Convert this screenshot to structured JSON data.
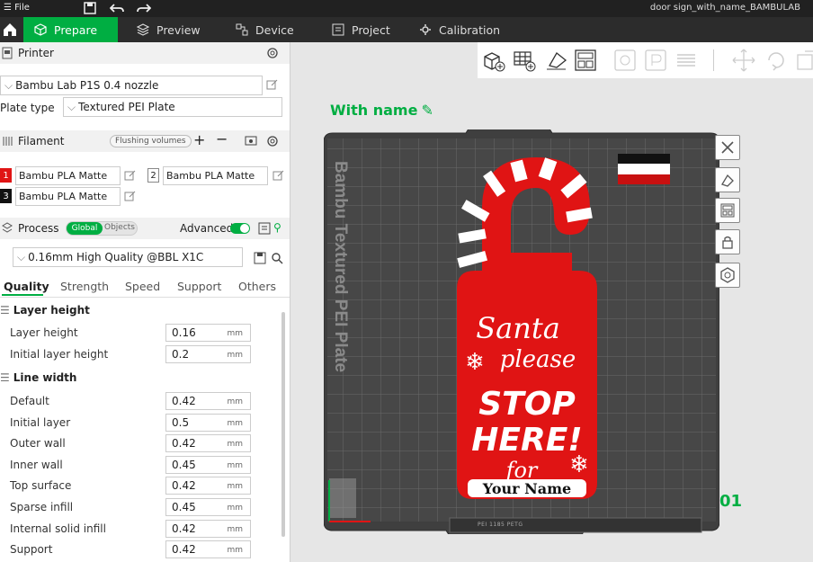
{
  "titlebar": {
    "menu_file": "File",
    "document_title": "door sign_with_name_BAMBULAB"
  },
  "tabs": [
    {
      "label": "Prepare"
    },
    {
      "label": "Preview"
    },
    {
      "label": "Device"
    },
    {
      "label": "Project"
    },
    {
      "label": "Calibration"
    }
  ],
  "printer": {
    "title": "Printer",
    "model": "Bambu Lab P1S 0.4 nozzle",
    "plate_type_label": "Plate type",
    "plate_type": "Textured PEI Plate"
  },
  "filament": {
    "title": "Filament",
    "flushing_label": "Flushing volumes",
    "slots": [
      {
        "num": "1",
        "name": "Bambu PLA Matte",
        "color": "#e01414"
      },
      {
        "num": "2",
        "name": "Bambu PLA Matte",
        "color": "#ffffff"
      },
      {
        "num": "3",
        "name": "Bambu PLA Matte",
        "color": "#111111"
      }
    ]
  },
  "process": {
    "title": "Process",
    "toggle_global": "Global",
    "toggle_objects": "Objects",
    "advanced_label": "Advanced",
    "preset": "0.16mm High Quality @BBL X1C",
    "tabs": [
      "Quality",
      "Strength",
      "Speed",
      "Support",
      "Others"
    ],
    "layer_height": {
      "group": "Layer height",
      "rows": [
        {
          "label": "Layer height",
          "value": "0.16",
          "unit": "mm"
        },
        {
          "label": "Initial layer height",
          "value": "0.2",
          "unit": "mm"
        }
      ]
    },
    "line_width": {
      "group": "Line width",
      "rows": [
        {
          "label": "Default",
          "value": "0.42",
          "unit": "mm"
        },
        {
          "label": "Initial layer",
          "value": "0.5",
          "unit": "mm"
        },
        {
          "label": "Outer wall",
          "value": "0.42",
          "unit": "mm"
        },
        {
          "label": "Inner wall",
          "value": "0.45",
          "unit": "mm"
        },
        {
          "label": "Top surface",
          "value": "0.42",
          "unit": "mm"
        },
        {
          "label": "Sparse infill",
          "value": "0.45",
          "unit": "mm"
        },
        {
          "label": "Internal solid infill",
          "value": "0.42",
          "unit": "mm"
        },
        {
          "label": "Support",
          "value": "0.42",
          "unit": "mm"
        }
      ]
    }
  },
  "viewport": {
    "object_name": "With name",
    "plate_label": "Bambu Textured PEI Plate",
    "plate_number": "01",
    "plate_footer": "PEI 1185 PETG",
    "sign": {
      "line1": "Santa",
      "line2": "please",
      "line3": "STOP",
      "line4": "HERE!",
      "line5": "for",
      "name": "Your Name"
    }
  },
  "colors": {
    "accent": "#00ae42",
    "sign_red": "#e01414",
    "plate": "#4a4a4a"
  }
}
